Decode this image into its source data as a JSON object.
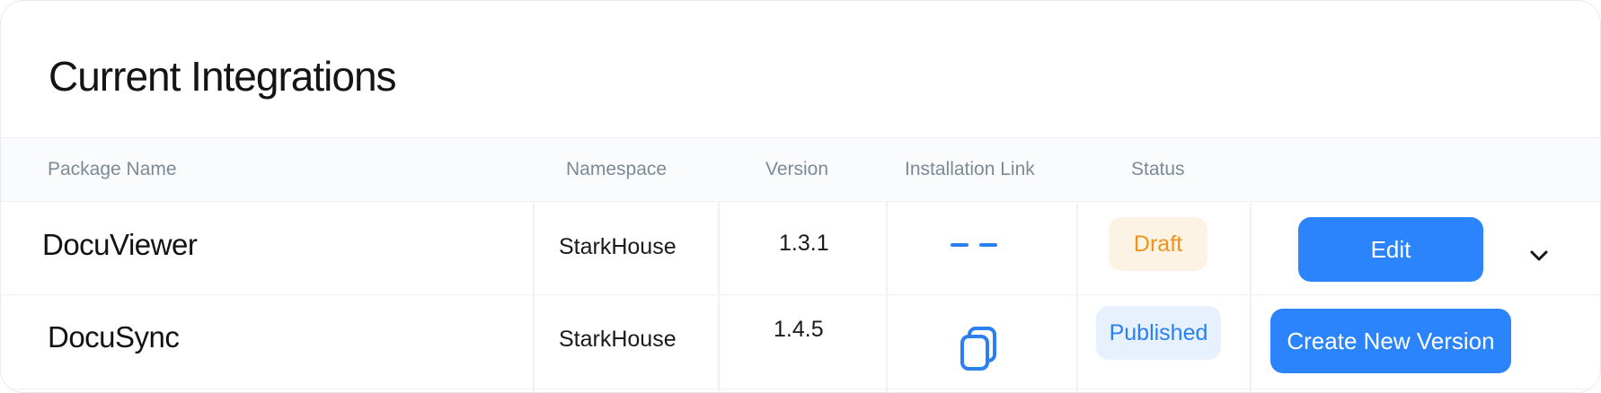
{
  "title": "Current Integrations",
  "columns": {
    "package_name": "Package Name",
    "namespace": "Namespace",
    "version": "Version",
    "installation_link": "Installation Link",
    "status": "Status"
  },
  "rows": [
    {
      "package_name": "DocuViewer",
      "namespace": "StarkHouse",
      "version": "1.3.1",
      "installation_link": "dashes-placeholder",
      "status": "Draft",
      "action": "Edit",
      "has_chevron": true
    },
    {
      "package_name": "DocuSync",
      "namespace": "StarkHouse",
      "version": "1.4.5",
      "installation_link": "copy-icon",
      "status": "Published",
      "action": "Create New Version",
      "has_chevron": false
    }
  ],
  "colors": {
    "accent": "#2b84fb",
    "draft_bg": "#fdf3e4",
    "draft_text": "#f0931a",
    "published_bg": "#e6f1fd",
    "published_text": "#2b7ff0"
  }
}
